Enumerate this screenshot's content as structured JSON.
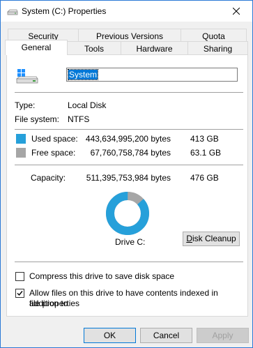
{
  "window": {
    "title": "System (C:) Properties",
    "close_icon": "close-icon"
  },
  "tabs": {
    "row1": [
      "Security",
      "Previous Versions",
      "Quota"
    ],
    "row2": [
      "General",
      "Tools",
      "Hardware",
      "Sharing"
    ],
    "active": "General"
  },
  "general": {
    "drive_name": "System",
    "type_label": "Type:",
    "type_value": "Local Disk",
    "fs_label": "File system:",
    "fs_value": "NTFS",
    "used_label": "Used space:",
    "used_bytes": "443,634,995,200 bytes",
    "used_size": "413 GB",
    "free_label": "Free space:",
    "free_bytes": "67,760,758,784 bytes",
    "free_size": "63.1 GB",
    "capacity_label": "Capacity:",
    "capacity_bytes": "511,395,753,984 bytes",
    "capacity_size": "476 GB",
    "drive_label": "Drive C:",
    "disk_cleanup": "Disk Cleanup",
    "compress_label": "Compress this drive to save disk space",
    "compress_checked": false,
    "index_label_line1": "Allow files on this drive to have contents indexed in addition to",
    "index_label_line2": "file properties",
    "index_checked": true,
    "used_fraction": 0.8675,
    "used_color": "#26a0da",
    "free_color": "#a6a6a6"
  },
  "buttons": {
    "ok": "OK",
    "cancel": "Cancel",
    "apply": "Apply"
  }
}
